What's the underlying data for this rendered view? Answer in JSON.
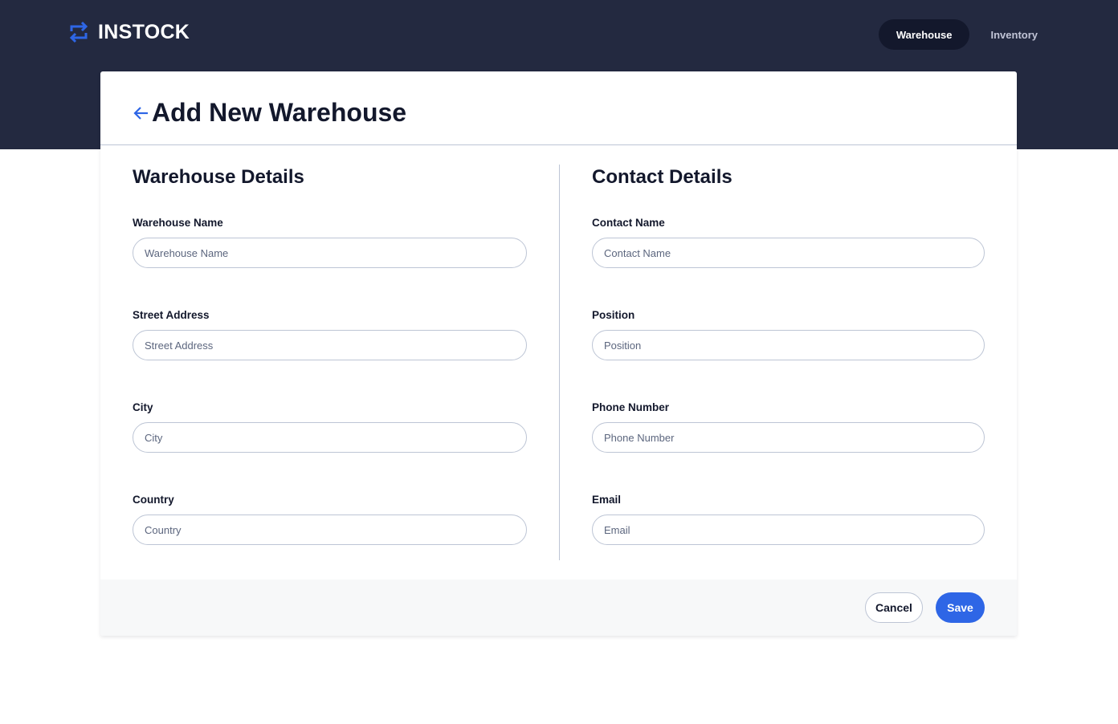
{
  "header": {
    "logo_text": "INSTOCK",
    "logo_icon": "swap-arrows-icon",
    "nav": [
      {
        "label": "Warehouse",
        "active": true
      },
      {
        "label": "Inventory",
        "active": false
      }
    ]
  },
  "page": {
    "title": "Add New Warehouse",
    "back_icon": "arrow-left-icon"
  },
  "warehouse_details": {
    "title": "Warehouse Details",
    "fields": [
      {
        "label": "Warehouse Name",
        "placeholder": "Warehouse Name",
        "value": ""
      },
      {
        "label": "Street Address",
        "placeholder": "Street Address",
        "value": ""
      },
      {
        "label": "City",
        "placeholder": "City",
        "value": ""
      },
      {
        "label": "Country",
        "placeholder": "Country",
        "value": ""
      }
    ]
  },
  "contact_details": {
    "title": "Contact Details",
    "fields": [
      {
        "label": "Contact Name",
        "placeholder": "Contact Name",
        "value": ""
      },
      {
        "label": "Position",
        "placeholder": "Position",
        "value": ""
      },
      {
        "label": "Phone Number",
        "placeholder": "Phone Number",
        "value": ""
      },
      {
        "label": "Email",
        "placeholder": "Email",
        "value": ""
      }
    ]
  },
  "actions": {
    "cancel_label": "Cancel",
    "save_label": "Save"
  },
  "colors": {
    "header_bg": "#232940",
    "text_dark": "#13182c",
    "accent_blue": "#2e66e6",
    "border": "#bdc5d5",
    "footer_bg": "#f7f8f9"
  }
}
